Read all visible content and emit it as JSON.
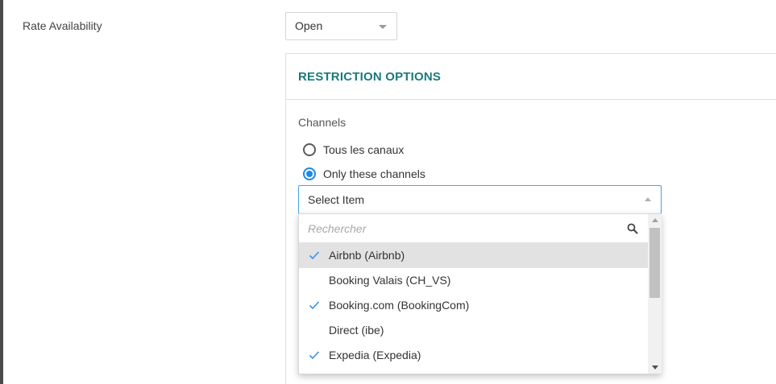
{
  "rate_availability": {
    "label": "Rate Availability",
    "selected": "Open"
  },
  "restriction": {
    "title": "RESTRICTION OPTIONS",
    "channels_label": "Channels",
    "radio_all": "Tous les canaux",
    "radio_only": "Only these channels",
    "selected_radio": "only",
    "select_placeholder": "Select Item"
  },
  "dropdown": {
    "search_placeholder": "Rechercher",
    "options": [
      {
        "label": "Airbnb (Airbnb)",
        "checked": true
      },
      {
        "label": "Booking Valais (CH_VS)",
        "checked": false
      },
      {
        "label": "Booking.com (BookingCom)",
        "checked": true
      },
      {
        "label": "Direct (ibe)",
        "checked": false
      },
      {
        "label": "Expedia (Expedia)",
        "checked": true
      }
    ]
  },
  "colors": {
    "accent_teal": "#1a7a7c",
    "accent_blue": "#1e88e5"
  }
}
